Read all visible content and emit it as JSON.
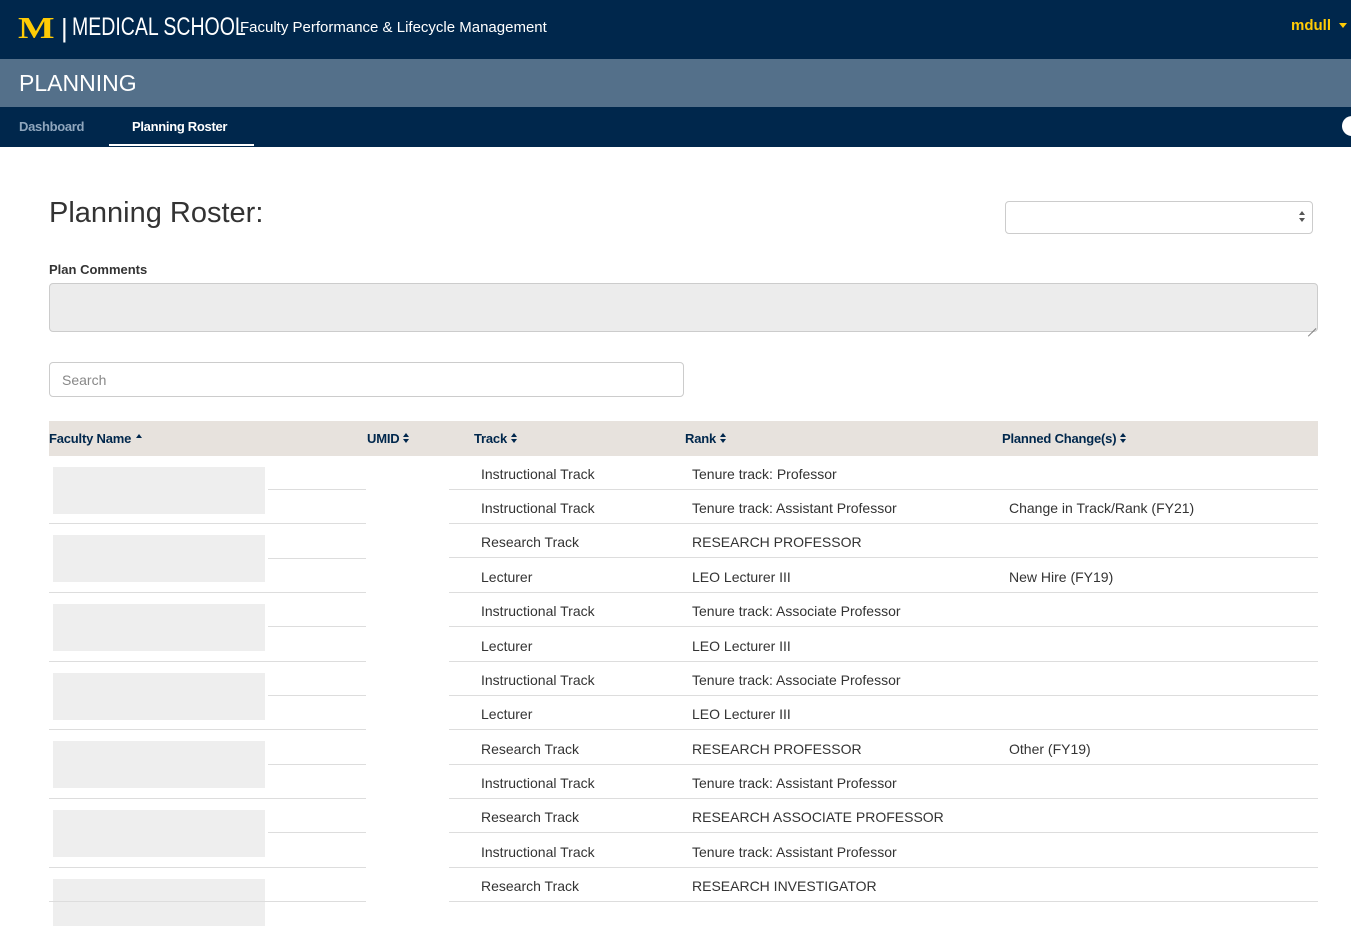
{
  "header": {
    "logo_mark": "M",
    "logo_text": "MEDICAL SCHOOL",
    "app_title": "Faculty Performance & Lifecycle Management",
    "username": "mdull",
    "brand_colors": {
      "navy": "#00274c",
      "maize": "#ffcb05",
      "section": "#54708a"
    }
  },
  "section": {
    "title": "PLANNING"
  },
  "nav": {
    "tabs": [
      {
        "label": "Dashboard",
        "active": false
      },
      {
        "label": "Planning Roster",
        "active": true
      }
    ],
    "help_icon": "help-circle-icon"
  },
  "page": {
    "title": "Planning Roster:",
    "plan_select_value": "",
    "plan_comments_label": "Plan Comments",
    "plan_comments_value": "",
    "search_placeholder": "Search"
  },
  "table": {
    "columns": [
      {
        "label": "Faculty Name",
        "sort": "asc"
      },
      {
        "label": "UMID",
        "sort": "both"
      },
      {
        "label": "Track",
        "sort": "both"
      },
      {
        "label": "Rank",
        "sort": "both"
      },
      {
        "label": "Planned Change(s)",
        "sort": "both"
      }
    ],
    "rows": [
      {
        "track": "Instructional Track",
        "rank": "Tenure track: Professor",
        "change": ""
      },
      {
        "track": "Instructional Track",
        "rank": "Tenure track: Assistant Professor",
        "change": "Change in Track/Rank (FY21)"
      },
      {
        "track": "Research Track",
        "rank": "RESEARCH PROFESSOR",
        "change": ""
      },
      {
        "track": "Lecturer",
        "rank": "LEO Lecturer III",
        "change": "New Hire (FY19)"
      },
      {
        "track": "Instructional Track",
        "rank": "Tenure track: Associate Professor",
        "change": ""
      },
      {
        "track": "Lecturer",
        "rank": "LEO Lecturer III",
        "change": ""
      },
      {
        "track": "Instructional Track",
        "rank": "Tenure track: Associate Professor",
        "change": ""
      },
      {
        "track": "Lecturer",
        "rank": "LEO Lecturer III",
        "change": ""
      },
      {
        "track": "Research Track",
        "rank": "RESEARCH PROFESSOR",
        "change": "Other (FY19)"
      },
      {
        "track": "Instructional Track",
        "rank": "Tenure track: Assistant Professor",
        "change": ""
      },
      {
        "track": "Research Track",
        "rank": "RESEARCH ASSOCIATE PROFESSOR",
        "change": ""
      },
      {
        "track": "Instructional Track",
        "rank": "Tenure track: Assistant Professor",
        "change": ""
      },
      {
        "track": "Research Track",
        "rank": "RESEARCH INVESTIGATOR",
        "change": ""
      }
    ]
  }
}
